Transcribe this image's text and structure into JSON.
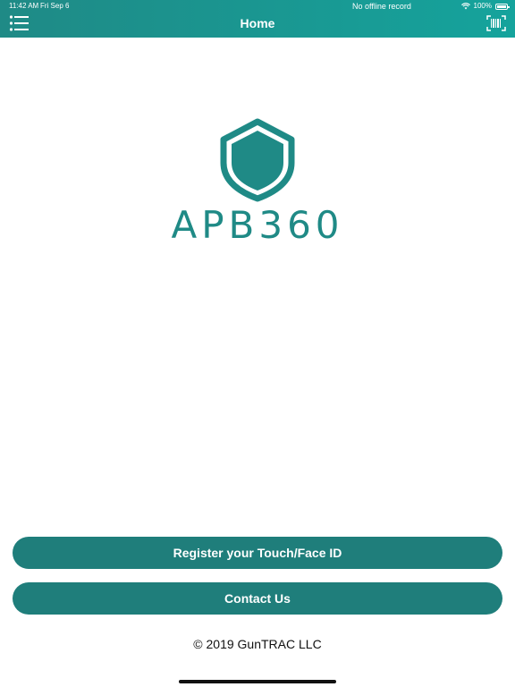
{
  "status_bar": {
    "time": "11:42 AM",
    "date": "Fri Sep 6",
    "center_text": "No offline record",
    "battery": "100%"
  },
  "header": {
    "title": "Home",
    "menu_icon": "list-menu-icon",
    "scan_icon": "barcode-scan-icon"
  },
  "logo": {
    "text": "APB360",
    "icon": "shield-icon"
  },
  "actions": {
    "register_label": "Register your Touch/Face ID",
    "contact_label": "Contact Us"
  },
  "footer": {
    "copyright": "© 2019 GunTRAC LLC"
  },
  "colors": {
    "header_start": "#1f8a86",
    "header_end": "#15a39c",
    "button": "#1f7e7b",
    "logo": "#1f8a86"
  }
}
